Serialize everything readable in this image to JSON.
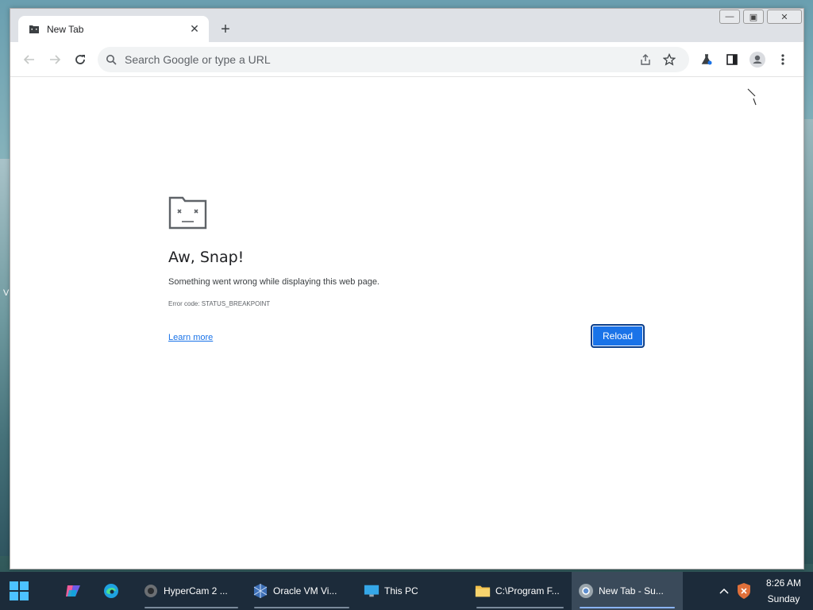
{
  "browser": {
    "tab": {
      "title": "New Tab"
    },
    "omnibox": {
      "placeholder": "Search Google or type a URL"
    }
  },
  "error_page": {
    "title": "Aw, Snap!",
    "message": "Something went wrong while displaying this web page.",
    "code": "Error code: STATUS_BREAKPOINT",
    "learn_more": "Learn more",
    "reload": "Reload"
  },
  "taskbar": {
    "apps": [
      {
        "label": "HyperCam 2 ..."
      },
      {
        "label": "Oracle VM Vi..."
      },
      {
        "label": "This PC"
      },
      {
        "label": "C:\\Program F..."
      },
      {
        "label": "New Tab - Su..."
      }
    ],
    "clock": {
      "time": "8:26 AM",
      "day": "Sunday"
    }
  },
  "colors": {
    "accent": "#1a73e8",
    "taskbar": "#1c2b3a",
    "tabstrip": "#dee1e6"
  }
}
